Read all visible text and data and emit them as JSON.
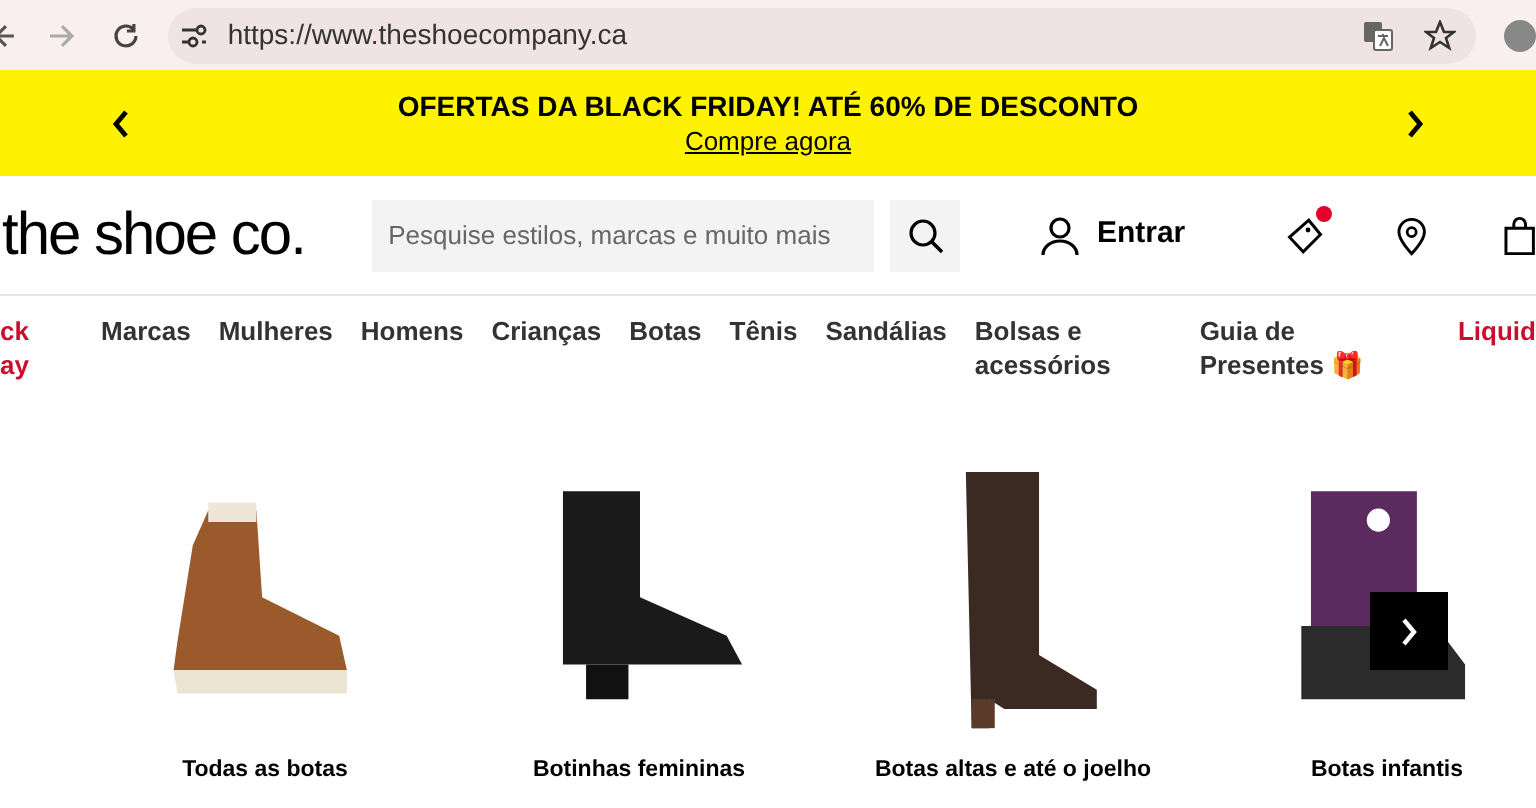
{
  "browser": {
    "url": "https://www.theshoecompany.ca"
  },
  "banner": {
    "headline": "OFERTAS DA BLACK FRIDAY! ATÉ 60% DE DESCONTO",
    "link": "Compre agora"
  },
  "header": {
    "logo": "the shoe co.",
    "search": {
      "placeholder": "Pesquise estilos, marcas e muito mais"
    },
    "sign_in": "Entrar",
    "wishlist_badge": true
  },
  "nav": [
    {
      "label": "ck ay",
      "kind": "promo"
    },
    {
      "label": "Marcas",
      "kind": "normal"
    },
    {
      "label": "Mulheres",
      "kind": "normal"
    },
    {
      "label": "Homens",
      "kind": "normal"
    },
    {
      "label": "Crianças",
      "kind": "normal"
    },
    {
      "label": "Botas",
      "kind": "normal"
    },
    {
      "label": "Tênis",
      "kind": "normal"
    },
    {
      "label": "Sandálias",
      "kind": "normal"
    },
    {
      "label": "Bolsas e acessórios",
      "kind": "normal"
    },
    {
      "label": "Guia de Presentes 🎁",
      "kind": "normal"
    },
    {
      "label": "Liquid",
      "kind": "promo"
    }
  ],
  "categories": [
    {
      "label": "Todas as botas",
      "kind": "hiker"
    },
    {
      "label": "Botinhas femininas",
      "kind": "chelsea"
    },
    {
      "label": "Botas altas e até o joelho",
      "kind": "tall"
    },
    {
      "label": "Botas infantis",
      "kind": "snow"
    }
  ]
}
